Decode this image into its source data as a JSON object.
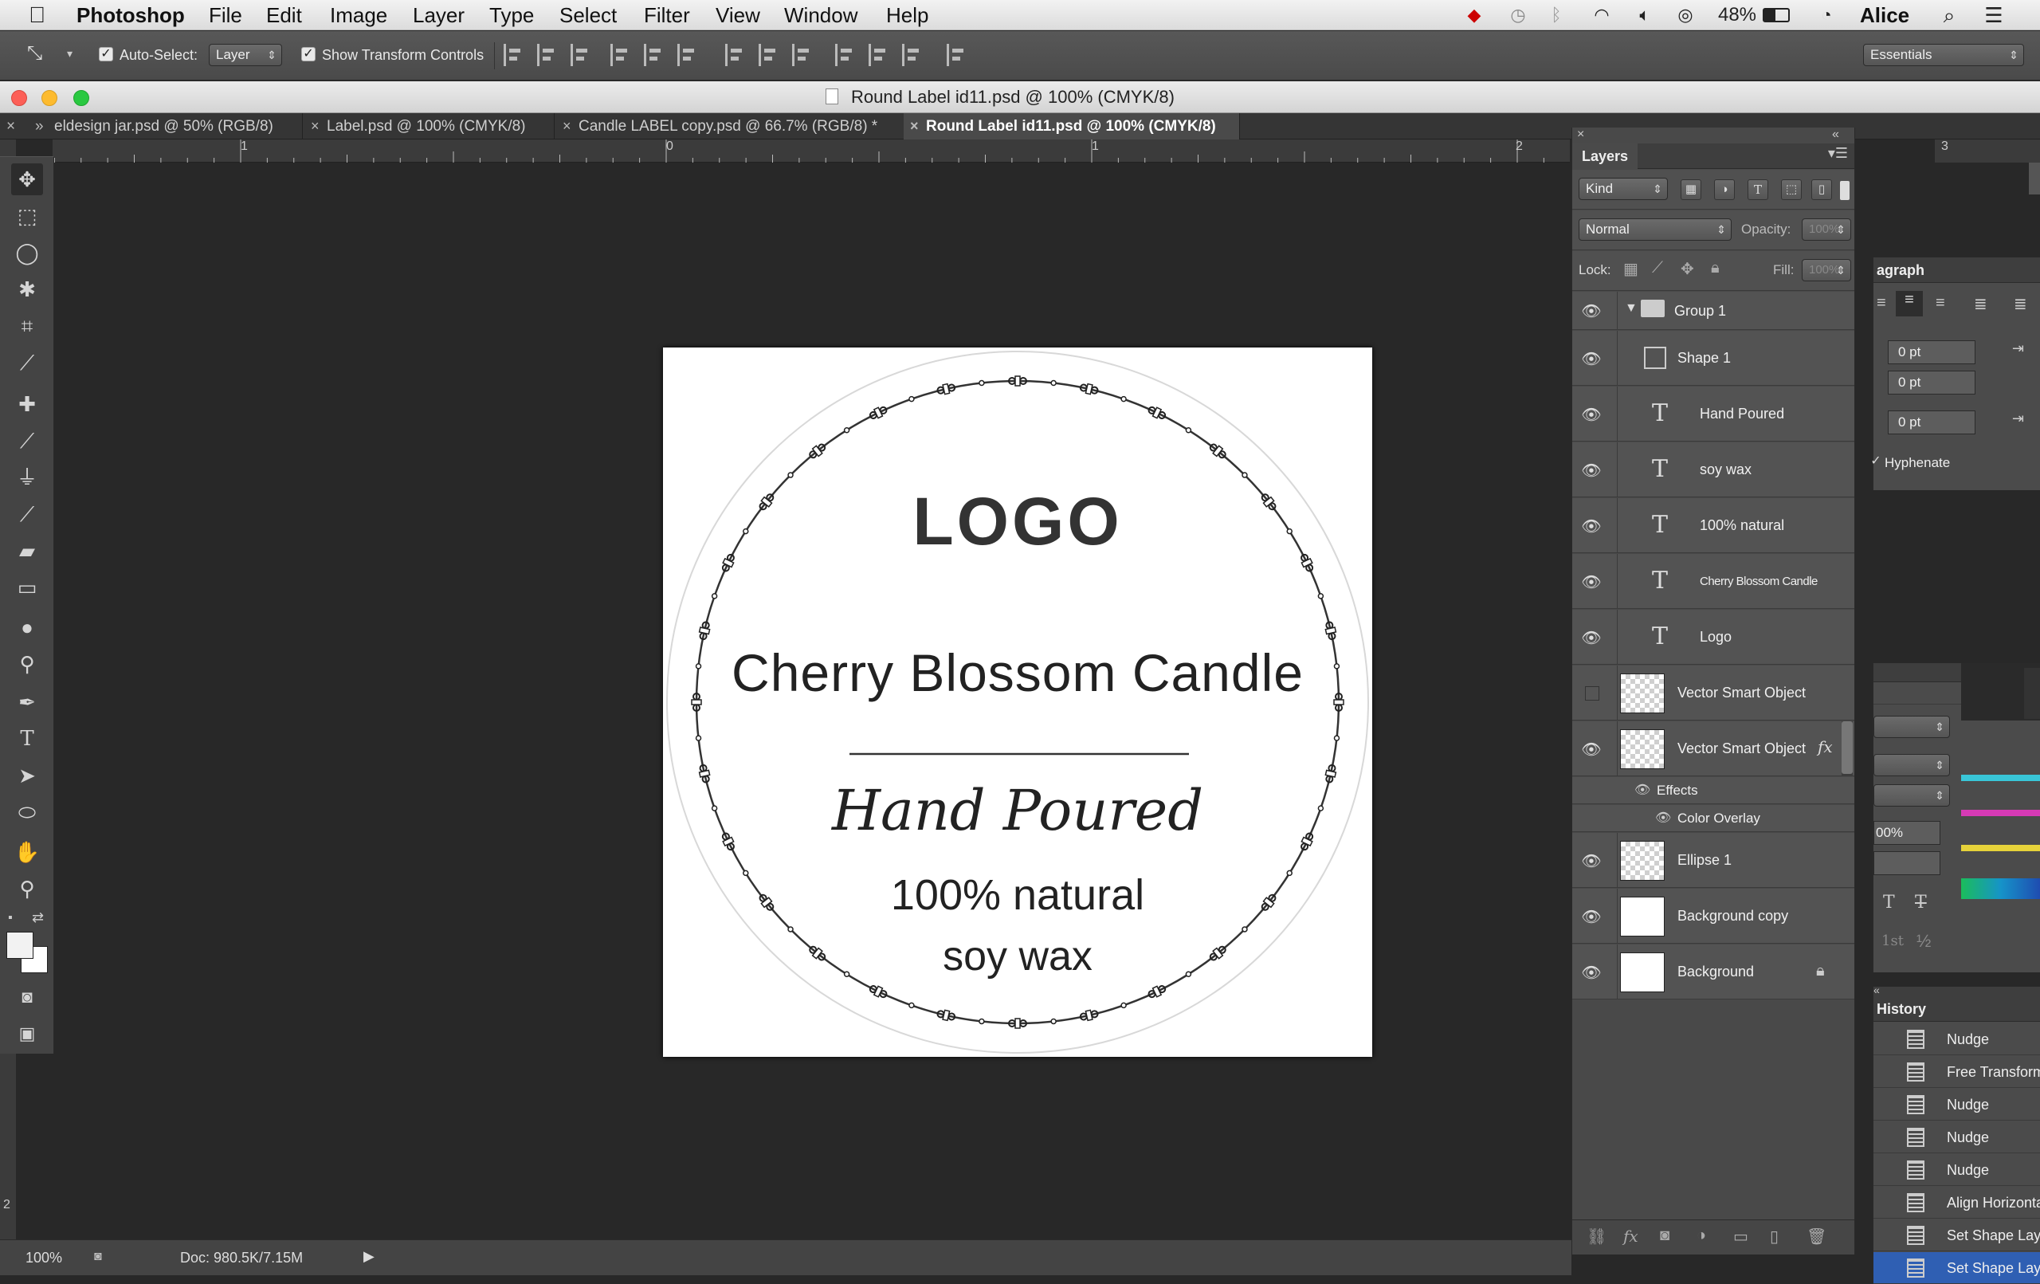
{
  "menubar": {
    "app": "Photoshop",
    "items": [
      "File",
      "Edit",
      "Image",
      "Layer",
      "Type",
      "Select",
      "Filter",
      "View",
      "Window",
      "Help"
    ],
    "battery": "48%",
    "user": "Alice"
  },
  "options": {
    "auto_select_label": "Auto-Select:",
    "auto_select_value": "Layer",
    "transform_label": "Show Transform Controls",
    "workspace": "Essentials"
  },
  "window": {
    "title": "Round Label id11.psd @ 100% (CMYK/8)"
  },
  "tabs": [
    {
      "label": "eldesign jar.psd @ 50% (RGB/8)"
    },
    {
      "label": "Label.psd @ 100% (CMYK/8)"
    },
    {
      "label": "Candle LABEL copy.psd @ 66.7% (RGB/8) *"
    },
    {
      "label": "Round Label id11.psd @ 100% (CMYK/8)"
    }
  ],
  "ruler": {
    "labels": [
      "1",
      "0",
      "1",
      "2",
      "3"
    ],
    "vlabel": "2"
  },
  "label_art": {
    "logo": "LOGO",
    "title": "Cherry Blossom Candle",
    "script": "Hand Poured",
    "line1": "100% natural",
    "line2": "soy wax"
  },
  "layers_panel": {
    "title": "Layers",
    "filter": "Kind",
    "blend": "Normal",
    "opacity_label": "Opacity:",
    "opacity": "100%",
    "lock_label": "Lock:",
    "fill_label": "Fill:",
    "fill": "100%",
    "layers": [
      {
        "name": "Group 1"
      },
      {
        "name": "Shape 1"
      },
      {
        "name": "Hand Poured"
      },
      {
        "name": "soy wax"
      },
      {
        "name": "100% natural"
      },
      {
        "name": "Cherry Blossom Candle"
      },
      {
        "name": "Logo"
      },
      {
        "name": "Vector Smart Object"
      },
      {
        "name": "Vector Smart Object"
      },
      {
        "name": "Ellipse 1"
      },
      {
        "name": "Background copy"
      },
      {
        "name": "Background"
      }
    ],
    "effects_label": "Effects",
    "color_overlay_label": "Color Overlay",
    "fx": "fx"
  },
  "paragraph_panel": {
    "title": "agraph",
    "fields": [
      "0 pt",
      "0 pt",
      "0 pt"
    ],
    "hyphenate": "Hyphenate"
  },
  "mid_panel": {
    "percent": "00%",
    "sup1": "1st",
    "frac": "½"
  },
  "history_panel": {
    "title": "History",
    "items": [
      "Nudge",
      "Free Transform",
      "Nudge",
      "Nudge",
      "Nudge",
      "Align Horizontal",
      "Set Shape Layer",
      "Set Shape Layer"
    ]
  },
  "status": {
    "zoom": "100%",
    "doc": "Doc: 980.5K/7.15M"
  }
}
